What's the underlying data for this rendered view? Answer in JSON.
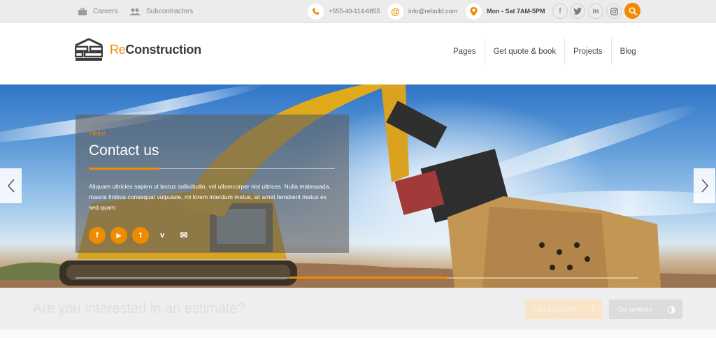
{
  "topbar": {
    "careers": "Careers",
    "subcontractors": "Subcontractors",
    "phone": "+555-40-114-6855",
    "email": "info@rebuild.com",
    "hours": "Mon - Sat 7AM-5PM",
    "social": [
      "facebook-icon",
      "twitter-icon",
      "linkedin-icon",
      "instagram-icon"
    ],
    "search_icon": "search-icon"
  },
  "header": {
    "brand_accent": "Re",
    "brand_rest": "Construction",
    "nav": [
      "Pages",
      "Get quote & book",
      "Projects",
      "Blog"
    ]
  },
  "hero": {
    "kicker": "Hello!",
    "title": "Contact us",
    "body": "Aliquam ultricies sapien ut lectus sollicitudin, vel ullamcorper nisl ultrices. Nulla malesuada, mauris finibus consequat vulputate, mi lorem interdum metus, sit amet hendrerit metus ex sed quam.",
    "social_glyphs": {
      "facebook": "f",
      "youtube": "▶",
      "tumblr": "t",
      "vimeo": "v",
      "mail": "✉"
    },
    "progress": 0.66,
    "prev_icon": "chevron-left-icon",
    "next_icon": "chevron-right-icon"
  },
  "cta": {
    "text": "Are you interested in an estimate?",
    "quote_label": "GET A QUOTE",
    "quote_icon": "?",
    "portfolio_label": "Our portfolio",
    "portfolio_icon": "half-circle-icon"
  },
  "colors": {
    "accent": "#f08a00",
    "topbar_bg": "#ececec",
    "caption_bg": "rgba(95,95,95,0.62)"
  }
}
